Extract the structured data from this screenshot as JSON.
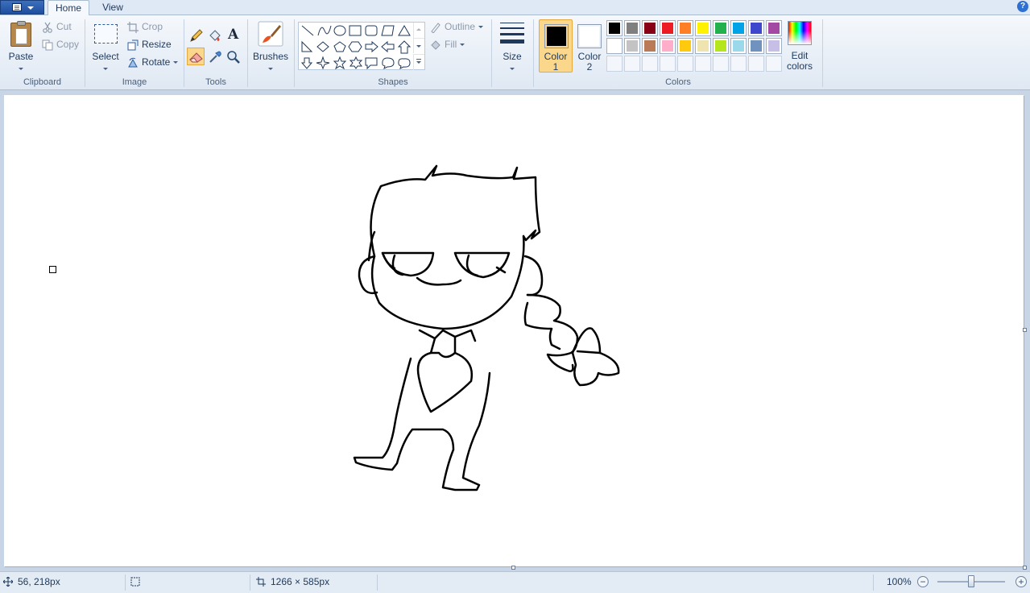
{
  "app_menu": {
    "icon": "paint-menu-icon"
  },
  "tabs": [
    {
      "label": "Home",
      "selected": true
    },
    {
      "label": "View",
      "selected": false
    }
  ],
  "help": {
    "icon": "help-icon",
    "glyph": "?"
  },
  "clipboard": {
    "paste_label": "Paste",
    "cut_label": "Cut",
    "copy_label": "Copy",
    "group_label": "Clipboard"
  },
  "image": {
    "select_label": "Select",
    "crop_label": "Crop",
    "resize_label": "Resize",
    "rotate_label": "Rotate",
    "group_label": "Image"
  },
  "tools": {
    "group_label": "Tools",
    "items": [
      "pencil-icon",
      "fill-icon",
      "text-icon",
      "eraser-icon",
      "color-picker-icon",
      "magnifier-icon"
    ],
    "active": "eraser-icon",
    "text_glyph": "A"
  },
  "brushes": {
    "label": "Brushes"
  },
  "shapes": {
    "group_label": "Shapes",
    "outline_label": "Outline",
    "fill_label": "Fill"
  },
  "size": {
    "label": "Size"
  },
  "colors": {
    "group_label": "Colors",
    "color1_label": "Color",
    "color1_num": "1",
    "color2_label": "Color",
    "color2_num": "2",
    "color1": "#000000",
    "color2": "#ffffff",
    "edit_label_1": "Edit",
    "edit_label_2": "colors",
    "palette_row1": [
      "#000000",
      "#7f7f7f",
      "#880015",
      "#ed1c24",
      "#ff7f27",
      "#fff200",
      "#22b14c",
      "#00a2e8",
      "#3f48cc",
      "#a349a4"
    ],
    "palette_row2": [
      "#ffffff",
      "#c3c3c3",
      "#b97a57",
      "#ffaec9",
      "#ffc90e",
      "#efe4b0",
      "#b5e61d",
      "#99d9ea",
      "#7092be",
      "#c8bfe7"
    ]
  },
  "status": {
    "cursor_position": "56, 218px",
    "selection_size": "",
    "image_size": "1266 × 585px",
    "zoom": "100%",
    "zoom_fraction": 0.5
  }
}
